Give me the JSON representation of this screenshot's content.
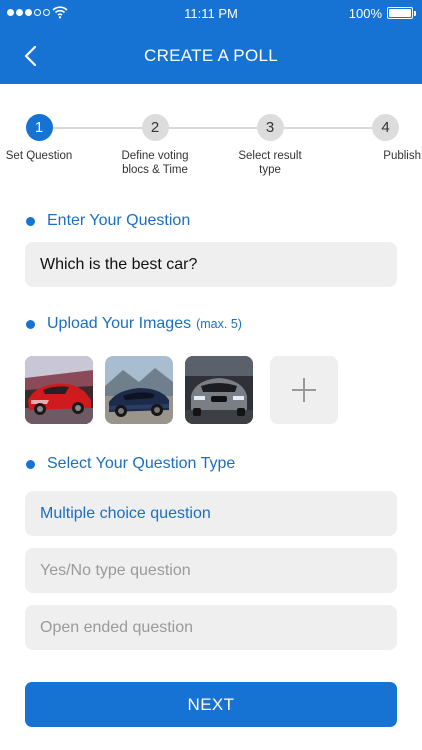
{
  "status_bar": {
    "time": "11:11 PM",
    "battery": "100%"
  },
  "header": {
    "title": "CREATE A POLL"
  },
  "steps": [
    {
      "number": "1",
      "label": "Set Question",
      "active": true
    },
    {
      "number": "2",
      "label": "Define voting blocs & Time",
      "active": false
    },
    {
      "number": "3",
      "label": "Select result type",
      "active": false
    },
    {
      "number": "4",
      "label": "Publish",
      "active": false
    }
  ],
  "question": {
    "heading": "Enter Your Question",
    "value": "Which is the best car?"
  },
  "images": {
    "heading": "Upload Your Images",
    "limit_note": "(max. 5)",
    "thumbnails": [
      "red sports car",
      "dark blue hypercar",
      "grey sedan"
    ]
  },
  "question_type": {
    "heading": "Select Your Question Type",
    "options": [
      "Multiple choice question",
      "Yes/No type question",
      "Open ended question"
    ],
    "selected": "Multiple choice question"
  },
  "next_button": "NEXT",
  "colors": {
    "primary": "#1673d3",
    "field_bg": "#efefef",
    "muted_text": "#9a9a9a"
  }
}
